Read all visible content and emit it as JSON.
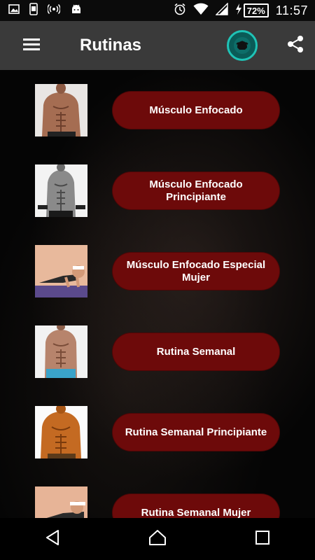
{
  "status_bar": {
    "time": "11:57",
    "battery_percent": "72%",
    "icons": [
      "image-icon",
      "phone-icon",
      "hotspot-icon",
      "android-icon",
      "alarm-icon",
      "wifi-icon",
      "signal-icon",
      "charging-icon"
    ]
  },
  "app_bar": {
    "title": "Rutinas",
    "menu_icon": "hamburger-icon",
    "logo_icon": "app-logo-icon",
    "share_icon": "share-icon"
  },
  "routines": [
    {
      "label": "Músculo Enfocado",
      "thumb": "male-torso-photo"
    },
    {
      "label": "Músculo Enfocado Principiante",
      "thumb": "male-bw-dumbbell-photo"
    },
    {
      "label": "Músculo Enfocado Especial Mujer",
      "thumb": "female-pushup-photo"
    },
    {
      "label": "Rutina Semanal",
      "thumb": "male-abs-photo"
    },
    {
      "label": "Rutina Semanal Principiante",
      "thumb": "male-tan-torso-photo"
    },
    {
      "label": "Rutina Semanal Mujer",
      "thumb": "female-exercise-photo"
    }
  ],
  "nav_bar": {
    "back_icon": "back-icon",
    "home_icon": "home-icon",
    "recents_icon": "recents-icon"
  },
  "colors": {
    "app_bar": "#3a3a3a",
    "button": "#6d0a0a",
    "accent": "#1fc3b6"
  }
}
